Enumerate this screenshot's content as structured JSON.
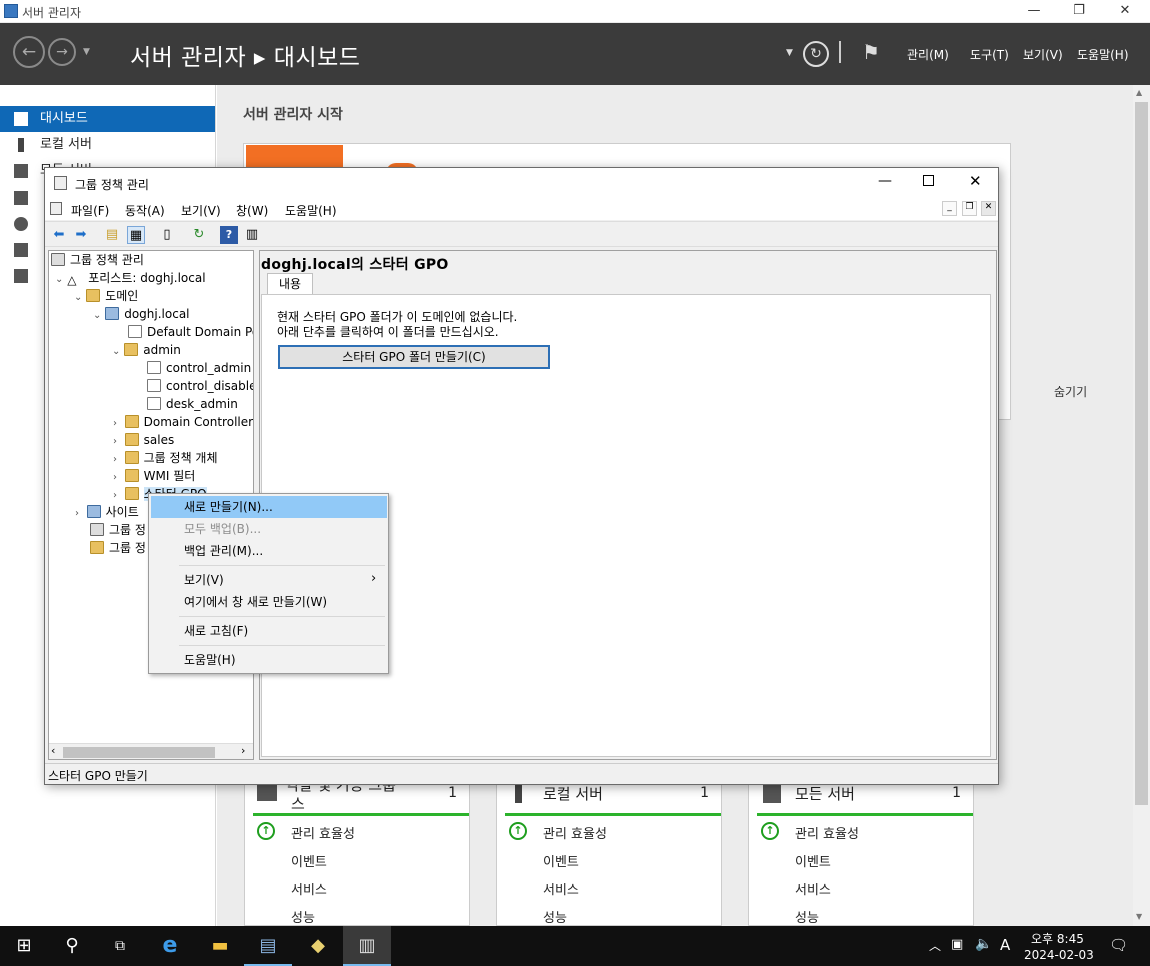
{
  "outer": {
    "title": "서버 관리자",
    "header_title": "서버 관리자 ▸ 대시보드",
    "menus": [
      "관리(M)",
      "도구(T)",
      "보기(V)",
      "도움말(H)"
    ],
    "nav": [
      "대시보드",
      "로컬 서버",
      "모든 서버"
    ],
    "quickstart_title": "서버 관리자 시작",
    "hide_link": "숨기기",
    "tiles": [
      {
        "title": "역할 및 기능 그룹",
        "title2": "스",
        "count": "1",
        "rows": [
          "관리 효율성",
          "이벤트",
          "서비스",
          "성능"
        ]
      },
      {
        "title": "로컬 서버",
        "count": "1",
        "rows": [
          "관리 효율성",
          "이벤트",
          "서비스",
          "성능"
        ]
      },
      {
        "title": "모든 서버",
        "count": "1",
        "rows": [
          "관리 효율성",
          "이벤트",
          "서비스",
          "성능"
        ]
      }
    ]
  },
  "gpm": {
    "title": "그룹 정책 관리",
    "menus": [
      "파일(F)",
      "동작(A)",
      "보기(V)",
      "창(W)",
      "도움말(H)"
    ],
    "tree": {
      "root": "그룹 정책 관리",
      "forest": "포리스트: doghj.local",
      "domains": "도메인",
      "domain": "doghj.local",
      "default_policy": "Default Domain Po",
      "admin": "admin",
      "control_admin": "control_admin",
      "control_disable": "control_disable_",
      "desk_admin": "desk_admin",
      "domain_controllers": "Domain Controllers",
      "sales": "sales",
      "gpo_objects": "그룹 정책 개체",
      "wmi": "WMI 필터",
      "starter": "스타터 GPO",
      "sites": "사이트",
      "modeling": "그룹 정",
      "results": "그룹 정"
    },
    "right": {
      "heading": "doghj.local의 스타터 GPO",
      "tab": "내용",
      "msg1": "현재 스타터 GPO 폴더가 이 도메인에 없습니다.",
      "msg2": "아래 단추를 클릭하여 이 폴더를 만드십시오.",
      "button": "스타터 GPO 폴더 만들기(C)"
    },
    "status": "스타터 GPO 만들기"
  },
  "context_menu": {
    "new": "새로 만들기(N)...",
    "backup_all": "모두 백업(B)...",
    "manage_backups": "백업 관리(M)...",
    "view": "보기(V)",
    "new_window": "여기에서 창 새로 만들기(W)",
    "refresh": "새로 고침(F)",
    "help": "도움말(H)"
  },
  "taskbar": {
    "time": "오후 8:45",
    "date": "2024-02-03",
    "ime": "A"
  },
  "colors": {
    "accent": "#0f68b6",
    "header": "#3b3b3b",
    "tile_bar": "#2cb32c",
    "menu_highlight": "#91c9f7"
  }
}
